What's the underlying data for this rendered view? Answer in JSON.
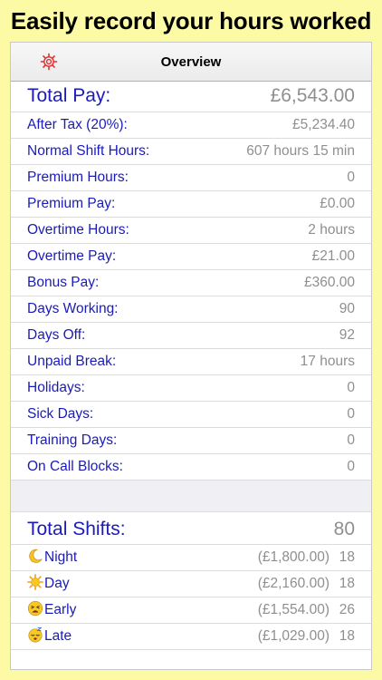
{
  "banner": "Easily record your hours worked",
  "nav": {
    "title": "Overview",
    "settings_icon": "gear-icon"
  },
  "total_pay": {
    "label": "Total Pay:",
    "value": "£6,543.00"
  },
  "rows": [
    {
      "label": "After Tax (20%):",
      "value": "£5,234.40"
    },
    {
      "label": "Normal Shift Hours:",
      "value": "607 hours 15 min"
    },
    {
      "label": "Premium Hours:",
      "value": "0"
    },
    {
      "label": "Premium Pay:",
      "value": "£0.00"
    },
    {
      "label": "Overtime Hours:",
      "value": "2 hours"
    },
    {
      "label": "Overtime Pay:",
      "value": "£21.00"
    },
    {
      "label": "Bonus Pay:",
      "value": "£360.00"
    },
    {
      "label": "Days Working:",
      "value": "90"
    },
    {
      "label": "Days Off:",
      "value": "92"
    },
    {
      "label": "Unpaid Break:",
      "value": "17 hours"
    },
    {
      "label": "Holidays:",
      "value": "0"
    },
    {
      "label": "Sick Days:",
      "value": "0"
    },
    {
      "label": "Training Days:",
      "value": "0"
    },
    {
      "label": "On Call Blocks:",
      "value": "0"
    }
  ],
  "total_shifts": {
    "label": "Total Shifts:",
    "value": "80"
  },
  "shifts": [
    {
      "icon": "moon-icon",
      "label": "Night",
      "amount": "(£1,800.00)",
      "count": "18"
    },
    {
      "icon": "sun-icon",
      "label": "Day",
      "amount": "(£2,160.00)",
      "count": "18"
    },
    {
      "icon": "tired-face-icon",
      "label": "Early",
      "amount": "(£1,554.00)",
      "count": "26"
    },
    {
      "icon": "sleeping-face-icon",
      "label": "Late",
      "amount": "(£1,029.00)",
      "count": "18"
    }
  ]
}
